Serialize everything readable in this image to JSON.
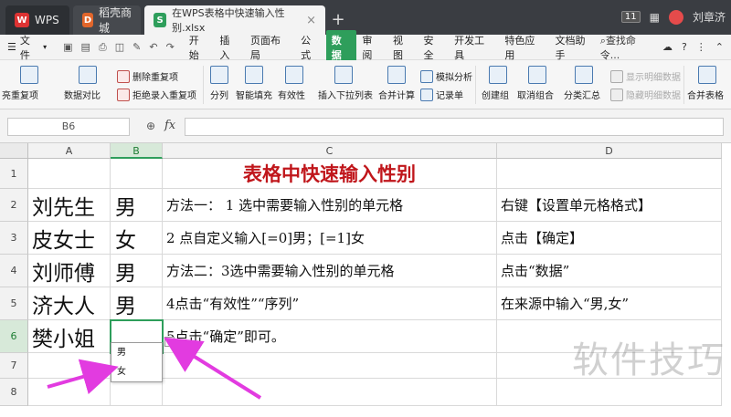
{
  "window": {
    "tabs": [
      {
        "label": "WPS",
        "logo": "W"
      },
      {
        "label": "稻壳商城",
        "logo": "D"
      },
      {
        "label": "在WPS表格中快速输入性别.xlsx",
        "logo": "S",
        "close": "×"
      }
    ],
    "add_tab": "+",
    "badge": "11",
    "user_name": "刘章济"
  },
  "menu": {
    "file_label": "文件",
    "items": [
      "开始",
      "插入",
      "页面布局",
      "公式",
      "数据",
      "审阅",
      "视图",
      "安全",
      "开发工具",
      "特色应用",
      "文档助手"
    ],
    "active": "数据",
    "search": "查找命令...",
    "help": "?"
  },
  "ribbon": {
    "remove_duplicates": "删除重复项",
    "reject_duplicates": "拒绝录入重复项",
    "highlight_duplicates": "亮重复项",
    "data_compare": "数据对比",
    "split": "分列",
    "smart_fill": "智能填充",
    "validity": "有效性",
    "insert_dropdown": "插入下拉列表",
    "consolidate": "合并计算",
    "what_if": "模拟分析",
    "record": "记录单",
    "create_group": "创建组",
    "ungroup": "取消组合",
    "subtotal": "分类汇总",
    "show_detail": "显示明细数据",
    "hide_detail": "隐藏明细数据",
    "merge_table": "合并表格"
  },
  "formula_bar": {
    "cell_ref": "B6",
    "fx": "fx",
    "value": ""
  },
  "sheet": {
    "columns": [
      "A",
      "B",
      "C",
      "D"
    ],
    "rows": [
      "1",
      "2",
      "3",
      "4",
      "5",
      "6",
      "7",
      "8"
    ],
    "title": "表格中快速输入性别",
    "names": [
      "刘先生",
      "皮女士",
      "刘师傅",
      "济大人",
      "樊小姐"
    ],
    "genders": [
      "男",
      "女",
      "男",
      "男",
      ""
    ],
    "notes_c": [
      "方法一： 1 选中需要输入性别的单元格",
      " 2 点自定义输入[=0]男；[=1]女",
      "方法二：3选中需要输入性别的单元格",
      "4点击“有效性”“序列”",
      "   5点击“确定”即可。"
    ],
    "notes_d": [
      "右键【设置单元格格式】",
      "点击【确定】",
      "点击“数据”",
      "在来源中输入“男,女”"
    ],
    "dropdown_options": [
      "男",
      "女"
    ],
    "dropdown_arrow": "▼"
  },
  "watermark": "软件技巧",
  "colors": {
    "accent": "#2e9e5b",
    "title_red": "#c0161b",
    "arrow_magenta": "#e23be0"
  }
}
